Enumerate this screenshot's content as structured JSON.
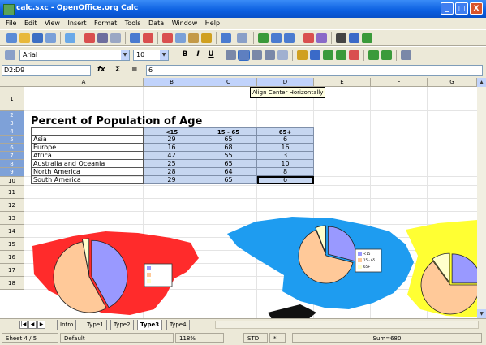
{
  "window": {
    "title": "calc.sxc - OpenOffice.org Calc",
    "minimize": "_",
    "maximize": "□",
    "close": "X"
  },
  "menu": [
    "File",
    "Edit",
    "View",
    "Insert",
    "Format",
    "Tools",
    "Data",
    "Window",
    "Help"
  ],
  "format_toolbar": {
    "style": "Default",
    "font_name": "Arial",
    "font_size": "10",
    "bold": "B",
    "italic": "I",
    "underline": "U"
  },
  "formula_bar": {
    "cell_ref": "D2:D9",
    "value": "6",
    "fx": "fx",
    "sum": "Σ",
    "equals": "="
  },
  "tooltip": "Align Center Horizontally",
  "columns": [
    "A",
    "B",
    "C",
    "D",
    "E",
    "F",
    "G"
  ],
  "rows": [
    "1",
    "2",
    "3",
    "4",
    "5",
    "6",
    "7",
    "8",
    "9",
    "10",
    "11",
    "12",
    "13",
    "14",
    "15",
    "16",
    "17",
    "18"
  ],
  "sheet": {
    "title": "Percent of Population of Age",
    "headers": [
      "<15",
      "15 - 65",
      "65+"
    ],
    "data": [
      {
        "region": "Asia",
        "v": [
          "29",
          "65",
          "6"
        ]
      },
      {
        "region": "Europe",
        "v": [
          "16",
          "68",
          "16"
        ]
      },
      {
        "region": "Africa",
        "v": [
          "42",
          "55",
          "3"
        ]
      },
      {
        "region": "Australia and Oceania",
        "v": [
          "25",
          "65",
          "10"
        ]
      },
      {
        "region": "North America",
        "v": [
          "28",
          "64",
          "8"
        ]
      },
      {
        "region": "South America",
        "v": [
          "29",
          "65",
          "6"
        ]
      }
    ]
  },
  "charts": {
    "africa": [
      42,
      55,
      3
    ],
    "asia": [
      29,
      65,
      6
    ],
    "australia": [
      25,
      65,
      10
    ],
    "colors": [
      "#9999ff",
      "#ffc999",
      "#ffffcc"
    ],
    "map_colors": {
      "africa": "#ff2b2b",
      "asia": "#1e9cf0",
      "oceania": "#ffff33",
      "antarctica": "#111111"
    }
  },
  "tabs": [
    "Intro",
    "Type1",
    "Type2",
    "Type3",
    "Type4"
  ],
  "active_tab": "Type3",
  "status": {
    "sheet": "Sheet 4 / 5",
    "style": "Default",
    "zoom": "118%",
    "mode": "STD",
    "star": "*",
    "sum": "Sum=680"
  }
}
